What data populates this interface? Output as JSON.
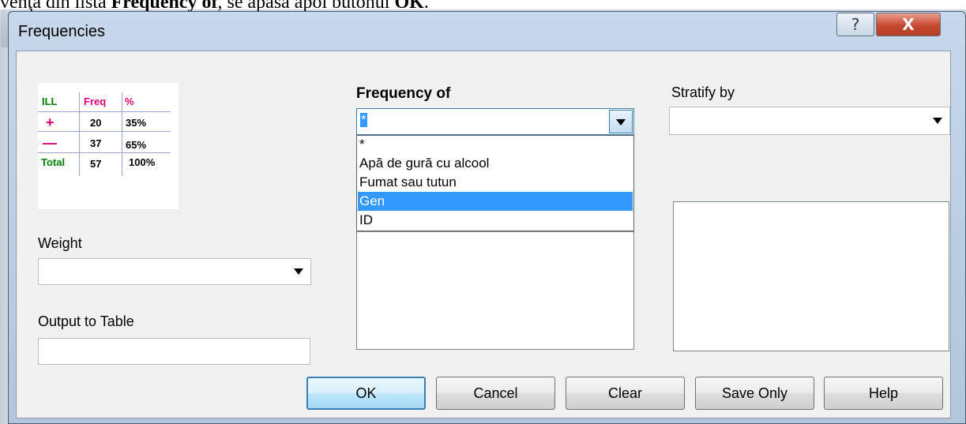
{
  "document": {
    "line_prefix": "venţa din lista ",
    "line_bold1": "Frequency of",
    "line_mid": ", se apasă apoi butonul ",
    "line_bold2": "OK",
    "line_end": "."
  },
  "dialog": {
    "title": "Frequencies",
    "help_glyph": "?",
    "close_glyph": "X"
  },
  "freq_icon": {
    "headers": [
      "ILL",
      "Freq",
      "%"
    ],
    "rows": [
      {
        "label": "+",
        "freq": "20",
        "pct": "35%"
      },
      {
        "label": "—",
        "freq": "37",
        "pct": "65%"
      },
      {
        "label": "Total",
        "freq": "57",
        "pct": "100%"
      }
    ],
    "colors": {
      "ill": "#008000",
      "freq": "#e0007a",
      "plus": "#e0007a"
    }
  },
  "frequency_of": {
    "label": "Frequency of",
    "selected_value": "*",
    "options": [
      "*",
      "Apă de gură cu alcool",
      "Fumat sau tutun",
      "Gen",
      "ID"
    ],
    "highlighted_option": "Gen"
  },
  "stratify_by": {
    "label": "Stratify by",
    "value": ""
  },
  "weight": {
    "label": "Weight",
    "value": ""
  },
  "output_to_table": {
    "label": "Output to Table",
    "value": ""
  },
  "buttons": {
    "ok": "OK",
    "cancel": "Cancel",
    "clear": "Clear",
    "save_only": "Save Only",
    "help": "Help"
  }
}
